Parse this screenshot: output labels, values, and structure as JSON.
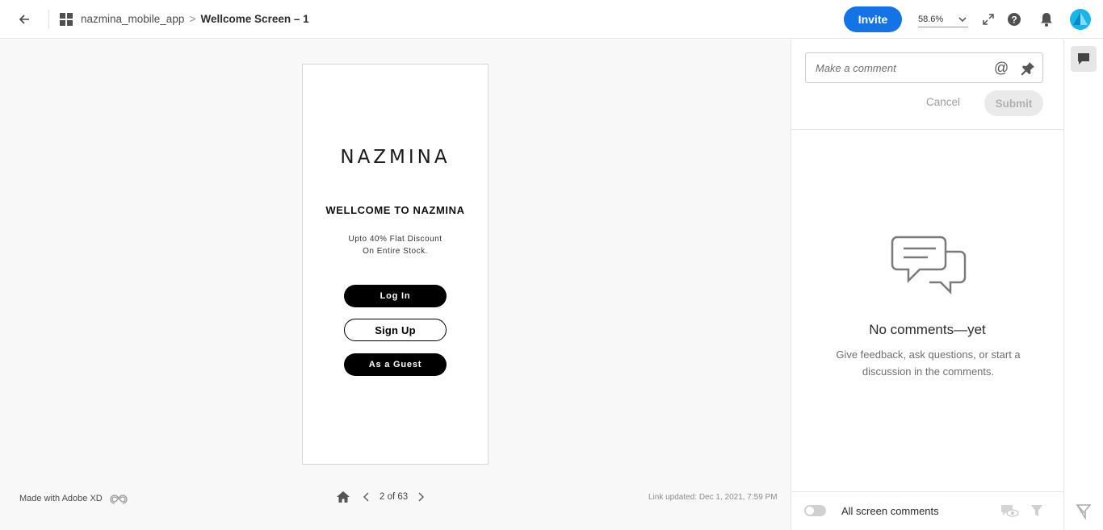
{
  "header": {
    "project": "nazmina_mobile_app",
    "separator": ">",
    "screen": "Wellcome Screen – 1",
    "invite_label": "Invite",
    "zoom": "58.6%"
  },
  "artboard": {
    "brand": "NAZMINA",
    "welcome": "WELLCOME TO NAZMINA",
    "promo_line1": "Upto 40% Flat Discount",
    "promo_line2": "On Entire Stock.",
    "login_label": "Log In",
    "signup_label": "Sign Up",
    "guest_label": "As a Guest"
  },
  "footer": {
    "made_with": "Made with Adobe XD",
    "page_indicator": "2 of 63",
    "link_updated": "Link updated: Dec 1, 2021, 7:59 PM"
  },
  "comments": {
    "placeholder": "Make a comment",
    "at_symbol": "@",
    "cancel_label": "Cancel",
    "submit_label": "Submit",
    "empty_title": "No comments—yet",
    "empty_desc": "Give feedback, ask questions, or start a discussion in the comments.",
    "filter_label": "All screen comments"
  },
  "colors": {
    "accent": "#1473e6",
    "avatar": "#19b5e6",
    "canvas_bg": "#f8f8f8"
  },
  "icons": [
    "back-arrow-icon",
    "grid-icon",
    "fullscreen-icon",
    "help-icon",
    "bell-icon",
    "comment-bubbles-icon",
    "pin-icon",
    "home-icon",
    "chevron-left-icon",
    "chevron-right-icon",
    "creative-cloud-icon",
    "hide-comments-icon",
    "filter-icon",
    "comment-icon"
  ]
}
